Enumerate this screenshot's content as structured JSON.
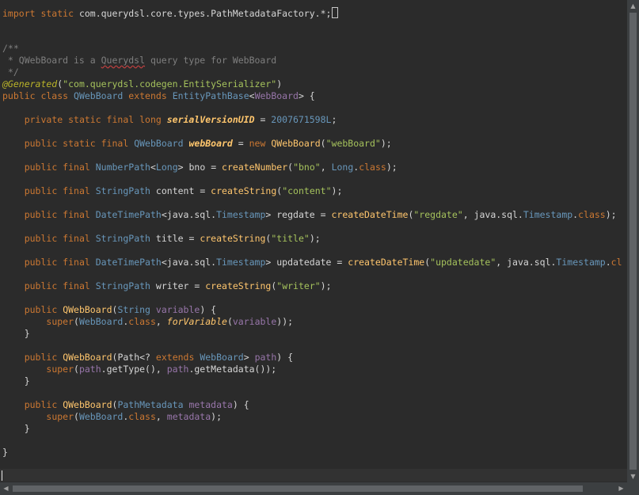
{
  "code": {
    "import_kw": "import static",
    "import_path": " com.querydsl.core.types.PathMetadataFactory.*;",
    "comment_open": "/**",
    "comment_line_pre": " * QWebBoard is a ",
    "comment_line_squiggle": "Querydsl",
    "comment_line_post": " query type for WebBoard",
    "comment_close": " */",
    "annotation": "@Generated",
    "annotation_arg": "\"com.querydsl.codegen.EntitySerializer\"",
    "class_decl": {
      "mods": "public class",
      "name": "QWebBoard",
      "extends_kw": "extends",
      "base": "EntityPathBase",
      "generic": "WebBoard"
    },
    "serial": {
      "mods": "private static final long",
      "name": "serialVersionUID",
      "value": "2007671598L"
    },
    "self": {
      "mods": "public static final",
      "type": "QWebBoard",
      "name": "webBoard",
      "new_kw": "new",
      "ctor": "QWebBoard",
      "arg": "\"webBoard\""
    },
    "bno": {
      "mods": "public final",
      "type": "NumberPath",
      "generic": "Long",
      "name": "bno",
      "call": "createNumber",
      "arg": "\"bno\"",
      "cls": "Long",
      "class_kw": "class"
    },
    "content": {
      "mods": "public final",
      "type": "StringPath",
      "name": "content",
      "call": "createString",
      "arg": "\"content\""
    },
    "regdate": {
      "mods": "public final",
      "type": "DateTimePath",
      "generic_pkg": "java.sql.",
      "generic": "Timestamp",
      "name": "regdate",
      "call": "createDateTime",
      "arg": "\"regdate\"",
      "cls_pkg": "java.sql.",
      "cls": "Timestamp",
      "class_kw": "class"
    },
    "title": {
      "mods": "public final",
      "type": "StringPath",
      "name": "title",
      "call": "createString",
      "arg": "\"title\""
    },
    "updatedate": {
      "mods": "public final",
      "type": "DateTimePath",
      "generic_pkg": "java.sql.",
      "generic": "Timestamp",
      "name": "updatedate",
      "call": "createDateTime",
      "arg": "\"updatedate\"",
      "cls_pkg": "java.sql.",
      "cls": "Timestamp",
      "class_kw": "cl"
    },
    "writer": {
      "mods": "public final",
      "type": "StringPath",
      "name": "writer",
      "call": "createString",
      "arg": "\"writer\""
    },
    "ctor1": {
      "mods": "public",
      "name": "QWebBoard",
      "ptype": "String",
      "pname": "variable",
      "super_kw": "super",
      "cls": "WebBoard",
      "class_kw": "class",
      "call": "forVariable",
      "arg": "variable"
    },
    "ctor2": {
      "mods": "public",
      "name": "QWebBoard",
      "ptype": "Path<?",
      "ext_kw": "extends",
      "pgen": "WebBoard",
      "pname": "path",
      "super_kw": "super",
      "arg1": "path",
      "m1": ".getType(), ",
      "arg2": "path",
      "m2": ".getMetadata());"
    },
    "ctor3": {
      "mods": "public",
      "name": "QWebBoard",
      "ptype": "PathMetadata",
      "pname": "metadata",
      "super_kw": "super",
      "cls": "WebBoard",
      "class_kw": "class",
      "arg": "metadata"
    }
  },
  "colors": {
    "background": "#2b2b2b",
    "keyword": "#cc7832",
    "type": "#6897bb",
    "string": "#a5c25c",
    "comment": "#7f7f7f",
    "annotation": "#bbb529",
    "method": "#ffc66d",
    "variable": "#9876aa"
  }
}
